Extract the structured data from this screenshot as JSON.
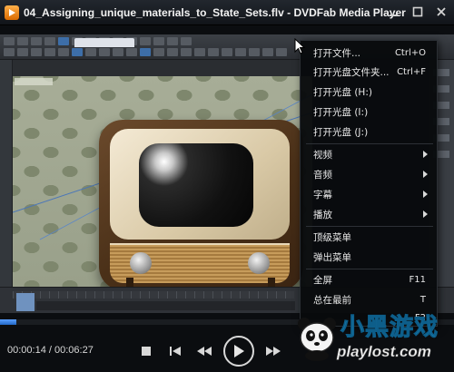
{
  "window": {
    "title": "04_Assigning_unique_materials_to_State_Sets.flv - DVDFab Media Player",
    "minimize_icon": "minimize-icon",
    "maximize_icon": "maximize-icon",
    "close_icon": "close-icon"
  },
  "context_menu": {
    "items": [
      {
        "label": "打开文件...",
        "shortcut": "Ctrl+O"
      },
      {
        "label": "打开光盘文件夹...",
        "shortcut": "Ctrl+F"
      },
      {
        "label": "打开光盘 (H:)",
        "shortcut": ""
      },
      {
        "label": "打开光盘 (I:)",
        "shortcut": ""
      },
      {
        "label": "打开光盘 (J:)",
        "shortcut": ""
      },
      {
        "label": "视频",
        "shortcut": "",
        "submenu": true
      },
      {
        "label": "音频",
        "shortcut": "",
        "submenu": true
      },
      {
        "label": "字幕",
        "shortcut": "",
        "submenu": true
      },
      {
        "label": "播放",
        "shortcut": "",
        "submenu": true
      },
      {
        "label": "顶级菜单",
        "shortcut": ""
      },
      {
        "label": "弹出菜单",
        "shortcut": ""
      },
      {
        "label": "全屏",
        "shortcut": "F11"
      },
      {
        "label": "总在最前",
        "shortcut": "T"
      },
      {
        "label": "",
        "shortcut": "F2"
      }
    ]
  },
  "playback": {
    "current_time": "00:00:14",
    "total_time": "00:06:27",
    "time_display": "00:00:14 / 00:06:27",
    "progress_fraction": 0.036
  },
  "controls": {
    "stop_icon": "stop-icon",
    "previous_icon": "previous-icon",
    "rewind_icon": "rewind-icon",
    "play_icon": "play-icon",
    "forward_icon": "fast-forward-icon"
  },
  "watermark": {
    "text": "小黑游戏",
    "url": "playlost.com"
  },
  "colors": {
    "accent": "#2f7fe0",
    "menu_bg": "#080a0c",
    "title_bg": "#1a1e24"
  }
}
